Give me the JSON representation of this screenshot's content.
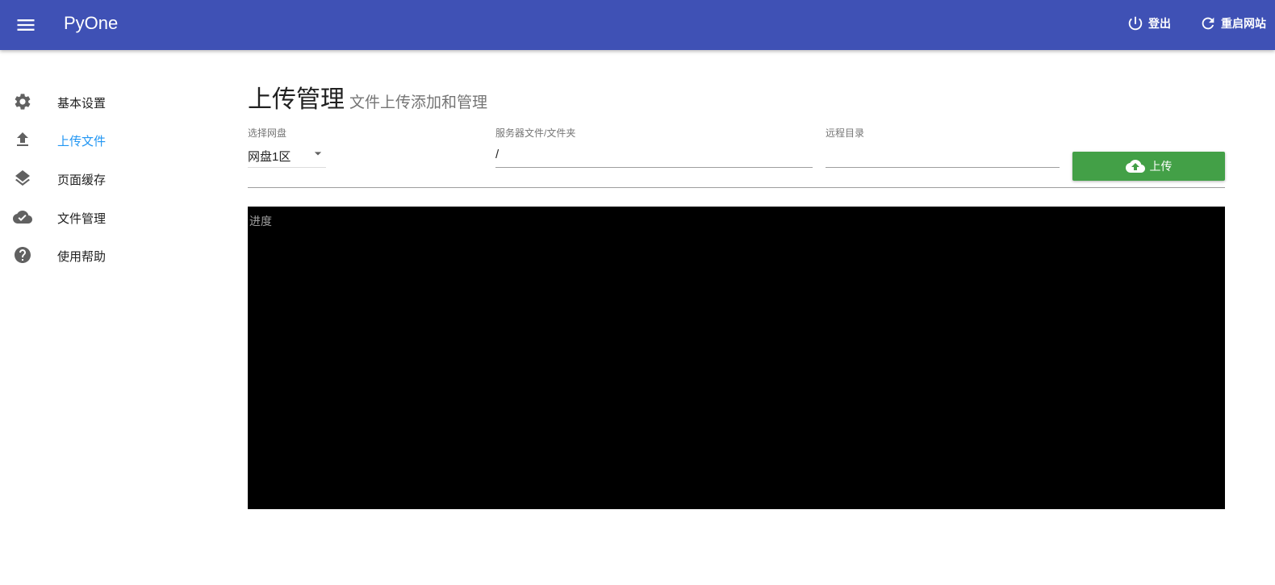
{
  "appbar": {
    "title": "PyOne",
    "logout_label": "登出",
    "restart_label": "重启网站",
    "color": "#3f51b5"
  },
  "sidebar": {
    "items": [
      {
        "label": "基本设置",
        "icon": "gear-icon",
        "active": false
      },
      {
        "label": "上传文件",
        "icon": "upload-icon",
        "active": true
      },
      {
        "label": "页面缓存",
        "icon": "layers-icon",
        "active": false
      },
      {
        "label": "文件管理",
        "icon": "cloud-done-icon",
        "active": false
      },
      {
        "label": "使用帮助",
        "icon": "help-icon",
        "active": false
      }
    ],
    "active_color": "#2196f3"
  },
  "main": {
    "title": "上传管理",
    "subtitle": "文件上传添加和管理",
    "disk_select": {
      "label": "选择网盘",
      "value": "网盘1区"
    },
    "server_path": {
      "label": "服务器文件/文件夹",
      "value": "/"
    },
    "remote_dir": {
      "label": "远程目录",
      "value": ""
    },
    "upload_button": {
      "label": "上传",
      "icon": "cloud-upload-icon",
      "color": "#43a047"
    },
    "progress": {
      "label": "进度"
    }
  }
}
